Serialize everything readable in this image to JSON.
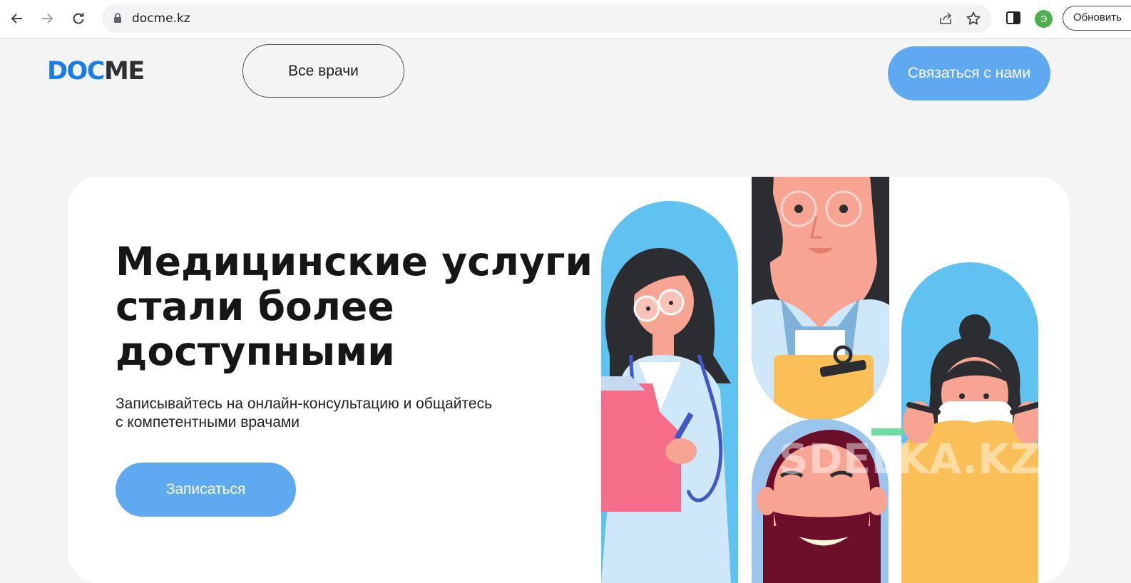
{
  "browser": {
    "url": "docme.kz",
    "profile_initial": "Э",
    "update_label": "Обновить"
  },
  "header": {
    "logo_part1": "DOC",
    "logo_part2": "ME",
    "all_doctors": "Все врачи",
    "contact": "Связаться с нами"
  },
  "hero": {
    "title_line1": "Медицинские услуги",
    "title_line2": "стали более",
    "title_line3": "доступными",
    "subtitle_line1": "Записывайтесь на онлайн-консультацию и общайтесь",
    "subtitle_line2": "с компетентными врачами",
    "signup": "Записаться",
    "watermark": "SDELKA.KZ"
  },
  "colors": {
    "accent": "#5ea9ef",
    "logo_blue": "#1a7de6",
    "logo_dark": "#2f3034",
    "illus_sky": "#5fc2f1",
    "illus_yellow": "#fbbf57",
    "illus_pink": "#f56d88"
  },
  "icons": [
    "back-arrow-icon",
    "forward-arrow-icon",
    "reload-icon",
    "lock-icon",
    "share-icon",
    "star-icon",
    "side-panel-icon"
  ]
}
